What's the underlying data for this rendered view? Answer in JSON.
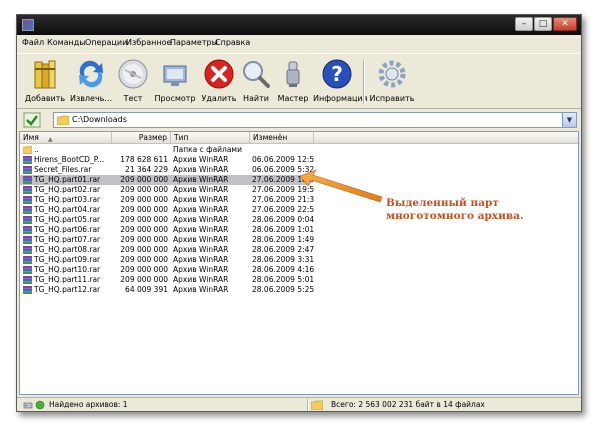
{
  "window": {
    "title": ""
  },
  "titlebar": {
    "min": "–",
    "max": "□",
    "close": "✕"
  },
  "menu": [
    "Файл",
    "Команды",
    "Операции",
    "Избранное",
    "Параметры",
    "Справка"
  ],
  "toolbar": [
    {
      "label": "Добавить",
      "icon": "books-icon"
    },
    {
      "label": "Извлечь...",
      "icon": "extract-arrow-icon"
    },
    {
      "label": "Тест",
      "icon": "disk-check-icon"
    },
    {
      "label": "Просмотр",
      "icon": "view-icon"
    },
    {
      "label": "Удалить",
      "icon": "delete-icon"
    },
    {
      "label": "Найти",
      "icon": "magnifier-icon"
    },
    {
      "label": "Мастер",
      "icon": "wizard-icon"
    },
    {
      "label": "Информация",
      "icon": "info-icon"
    },
    {
      "label": "Исправить",
      "icon": "repair-icon"
    }
  ],
  "address": {
    "path": "C:\\Downloads",
    "dropdown": "▼"
  },
  "columns": {
    "name": "Имя",
    "size": "Размер",
    "type": "Тип",
    "modified": "Изменён"
  },
  "files": [
    {
      "name": "..",
      "size": "",
      "type": "Папка с файлами",
      "modified": "",
      "kind": "folder"
    },
    {
      "name": "Hirens_BootCD_P...",
      "size": "178 628 611",
      "type": "Архив WinRAR",
      "modified": "06.06.2009 12:56",
      "kind": "rar"
    },
    {
      "name": "Secret_Files.rar",
      "size": "21 364 229",
      "type": "Архив WinRAR",
      "modified": "06.06.2009 5:32",
      "kind": "rar"
    },
    {
      "name": "TG_HQ.part01.rar",
      "size": "209 000 000",
      "type": "Архив WinRAR",
      "modified": "27.06.2009 18:31",
      "kind": "rar"
    },
    {
      "name": "TG_HQ.part02.rar",
      "size": "209 000 000",
      "type": "Архив WinRAR",
      "modified": "27.06.2009 19:53",
      "kind": "rar"
    },
    {
      "name": "TG_HQ.part03.rar",
      "size": "209 000 000",
      "type": "Архив WinRAR",
      "modified": "27.06.2009 21:35",
      "kind": "rar"
    },
    {
      "name": "TG_HQ.part04.rar",
      "size": "209 000 000",
      "type": "Архив WinRAR",
      "modified": "27.06.2009 22:53",
      "kind": "rar"
    },
    {
      "name": "TG_HQ.part05.rar",
      "size": "209 000 000",
      "type": "Архив WinRAR",
      "modified": "28.06.2009 0:04",
      "kind": "rar"
    },
    {
      "name": "TG_HQ.part06.rar",
      "size": "209 000 000",
      "type": "Архив WinRAR",
      "modified": "28.06.2009 1:01",
      "kind": "rar"
    },
    {
      "name": "TG_HQ.part07.rar",
      "size": "209 000 000",
      "type": "Архив WinRAR",
      "modified": "28.06.2009 1:49",
      "kind": "rar"
    },
    {
      "name": "TG_HQ.part08.rar",
      "size": "209 000 000",
      "type": "Архив WinRAR",
      "modified": "28.06.2009 2:47",
      "kind": "rar"
    },
    {
      "name": "TG_HQ.part09.rar",
      "size": "209 000 000",
      "type": "Архив WinRAR",
      "modified": "28.06.2009 3:31",
      "kind": "rar"
    },
    {
      "name": "TG_HQ.part10.rar",
      "size": "209 000 000",
      "type": "Архив WinRAR",
      "modified": "28.06.2009 4:16",
      "kind": "rar"
    },
    {
      "name": "TG_HQ.part11.rar",
      "size": "209 000 000",
      "type": "Архив WinRAR",
      "modified": "28.06.2009 5:01",
      "kind": "rar"
    },
    {
      "name": "TG_HQ.part12.rar",
      "size": "64 009 391",
      "type": "Архив WinRAR",
      "modified": "28.06.2009 5:25",
      "kind": "rar"
    }
  ],
  "selected_file": "TG_HQ.part01.rar",
  "status": {
    "left": "Найдено архивов: 1",
    "right": "Всего: 2 563 002 231 байт в 14 файлах"
  },
  "annotation": {
    "line1": "Выделенный парт",
    "line2": "многотомного архива."
  },
  "colors": {
    "annotation": "#c4501d",
    "selection": "#c3c1c6",
    "titlebar": "#1a1a1a"
  }
}
